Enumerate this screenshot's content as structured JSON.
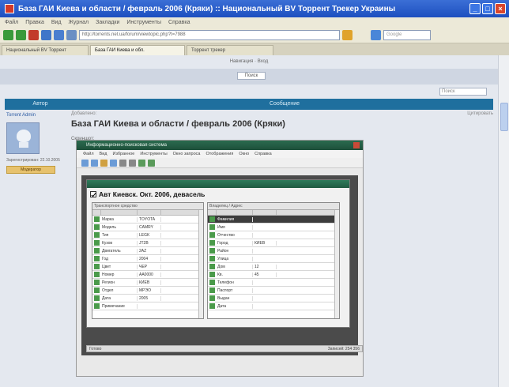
{
  "window": {
    "title": "База ГАИ Киева и области / февраль 2006 (Кряки) :: Национальный BV Торрент Трекер Украины"
  },
  "browser": {
    "menu": [
      "Файл",
      "Правка",
      "Вид",
      "Журнал",
      "Закладки",
      "Инструменты",
      "Справка"
    ],
    "address": "http://torrents.net.ua/forum/viewtopic.php?t=7988",
    "search_placeholder": "Google",
    "tabs": [
      {
        "label": "Национальный BV Торрент",
        "active": false
      },
      {
        "label": "База ГАИ Киева и обл.",
        "active": true
      },
      {
        "label": "Торрент трекер",
        "active": false
      }
    ]
  },
  "forum": {
    "top_links": "Навигация · Вход",
    "band_button": "Поиск",
    "search_placeholder": "Поиск",
    "nav": [
      "Автор",
      "Сообщение"
    ],
    "user": {
      "name": "Torrent Admin",
      "meta": "Зарегистрирован: 22.10.2005",
      "badge": "Модератор"
    },
    "post": {
      "meta_left": "Добавлено:",
      "meta_right": "Цитировать",
      "title": "База ГАИ Киева и области / февраль 2006 (Кряки)",
      "label": "Скриншот:"
    }
  },
  "screenshot_app": {
    "title": "Информационно-поисковая система",
    "menu": [
      "Файл",
      "Вид",
      "Избранное",
      "Инструменты",
      "Окно запроса",
      "Отображения",
      "Окно",
      "Справка"
    ],
    "heading": "Авт Киевск. Окт. 2006, девасель",
    "left_panel": {
      "caption": "Транспортное средство",
      "rows": [
        {
          "name": "Марка",
          "value": "TOYOTA",
          "selected": false
        },
        {
          "name": "Модель",
          "value": "CAMRY",
          "selected": false
        },
        {
          "name": "Тип",
          "value": "LEGK",
          "selected": false
        },
        {
          "name": "Кузов",
          "value": "JT2B",
          "selected": false
        },
        {
          "name": "Двигатель",
          "value": "2AZ",
          "selected": false
        },
        {
          "name": "Год",
          "value": "2004",
          "selected": false
        },
        {
          "name": "Цвет",
          "value": "ЧЕР",
          "selected": false
        },
        {
          "name": "Номер",
          "value": "AA0000",
          "selected": false
        },
        {
          "name": "Регион",
          "value": "КИЕВ",
          "selected": false
        },
        {
          "name": "Отдел",
          "value": "МРЭО",
          "selected": false
        },
        {
          "name": "Дата",
          "value": "2005",
          "selected": false
        },
        {
          "name": "Примечание",
          "value": "",
          "selected": false
        }
      ]
    },
    "right_panel": {
      "caption": "Владелец / Адрес",
      "rows": [
        {
          "name": "Фамилия",
          "value": "",
          "selected": true
        },
        {
          "name": "Имя",
          "value": "",
          "selected": false
        },
        {
          "name": "Отчество",
          "value": "",
          "selected": false
        },
        {
          "name": "Город",
          "value": "КИЕВ",
          "selected": false
        },
        {
          "name": "Район",
          "value": "",
          "selected": false
        },
        {
          "name": "Улица",
          "value": "",
          "selected": false
        },
        {
          "name": "Дом",
          "value": "12",
          "selected": false
        },
        {
          "name": "Кв.",
          "value": "45",
          "selected": false
        },
        {
          "name": "Телефон",
          "value": "",
          "selected": false
        },
        {
          "name": "Паспорт",
          "value": "",
          "selected": false
        },
        {
          "name": "Выдан",
          "value": "",
          "selected": false
        },
        {
          "name": "Дата",
          "value": "",
          "selected": false
        }
      ]
    },
    "status_left": "Готово",
    "status_right": "Записей: 254 356"
  },
  "colors": {
    "titlebar": "#1d4fc0",
    "forum_nav": "#1f6f9e",
    "app_title": "#2b6b4f"
  }
}
